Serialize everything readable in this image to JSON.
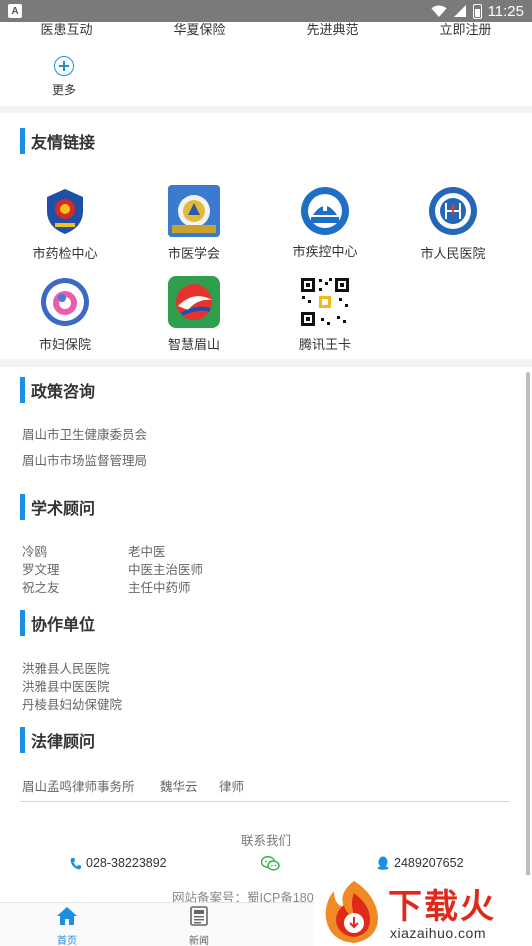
{
  "status_bar": {
    "time": "11:25"
  },
  "quick_links": [
    "医患互动",
    "华夏保险",
    "先进典范",
    "立即注册"
  ],
  "more_label": "更多",
  "friend_links": {
    "title": "友情链接",
    "items": [
      {
        "label": "市药检中心",
        "icon": "police-emblem-icon"
      },
      {
        "label": "市医学会",
        "icon": "medical-association-icon"
      },
      {
        "label": "市疾控中心",
        "icon": "cdc-icon"
      },
      {
        "label": "市人民医院",
        "icon": "peoples-hospital-icon"
      },
      {
        "label": "市妇保院",
        "icon": "maternal-hospital-icon"
      },
      {
        "label": "智慧眉山",
        "icon": "smart-meishan-icon"
      },
      {
        "label": "腾讯王卡",
        "icon": "qr-code-icon"
      }
    ]
  },
  "policy": {
    "title": "政策咨询",
    "items": [
      "眉山市卫生健康委员会",
      "眉山市市场监督管理局"
    ]
  },
  "academic": {
    "title": "学术顾问",
    "rows": [
      [
        "冷鸥",
        "老中医"
      ],
      [
        "罗文理",
        "中医主治医师"
      ],
      [
        "祝之友",
        "主任中药师"
      ]
    ]
  },
  "partners": {
    "title": "协作单位",
    "items": [
      "洪雅县人民医院",
      "洪雅县中医医院",
      "丹棱县妇幼保健院"
    ]
  },
  "legal": {
    "title": "法律顾问",
    "firm": "眉山孟鸣律师事务所",
    "name": "魏华云",
    "role": "律师"
  },
  "contact": {
    "title": "联系我们",
    "phone": "028-38223892",
    "qq": "2489207652",
    "icp": "网站备案号：蜀ICP备180"
  },
  "bottom_nav": {
    "home": "首页",
    "news": "新闻"
  },
  "watermark": {
    "main": "下载火",
    "sub": "xiazaihuo.com"
  },
  "colors": {
    "accent": "#1a8fe3",
    "watermark_red": "#e0281b"
  }
}
